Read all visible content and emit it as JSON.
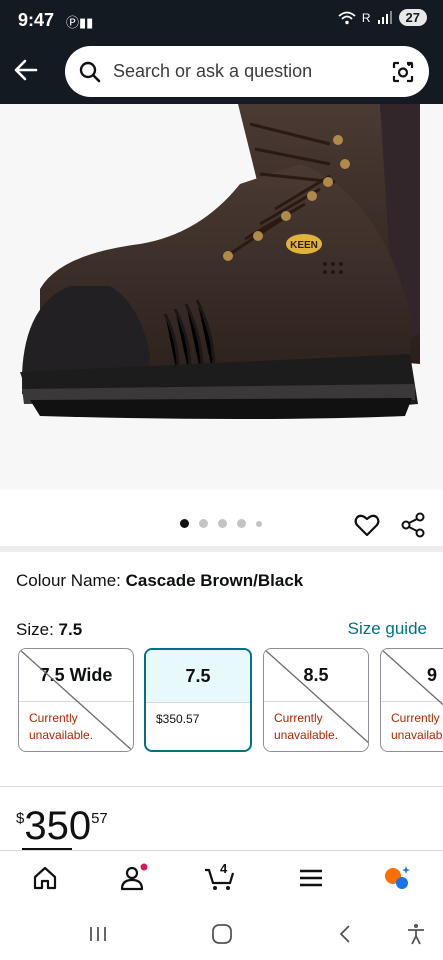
{
  "status_bar": {
    "time": "9:47",
    "extra": "Ⓟ▮▮",
    "signal": "R",
    "battery": "27"
  },
  "header": {
    "search_placeholder": "Search or ask a question"
  },
  "product": {
    "image_alt": "Brown leather work boot",
    "logo_text": "KEEN"
  },
  "gallery": {
    "image_count": 5,
    "active_index": 0
  },
  "colour": {
    "label": "Colour Name: ",
    "value": "Cascade Brown/Black"
  },
  "size": {
    "label": "Size: ",
    "value": "7.5",
    "guide_link": "Size guide",
    "options": [
      {
        "size": "7.5 Wide",
        "status": "Currently unavailable.",
        "available": false,
        "selected": false
      },
      {
        "size": "7.5",
        "status": "$350.57",
        "available": true,
        "selected": true
      },
      {
        "size": "8.5",
        "status": "Currently unavailable.",
        "available": false,
        "selected": false
      },
      {
        "size": "9",
        "status": "Currently unavailable.",
        "available": false,
        "selected": false
      }
    ]
  },
  "price": {
    "symbol": "$",
    "whole": "350",
    "fraction": "57"
  },
  "bottom_nav": {
    "cart_count": "4"
  },
  "colors": {
    "header_bg": "#131a22",
    "link": "#007185",
    "unavailable": "#b12704",
    "selected_bg": "#e8f9fb"
  }
}
